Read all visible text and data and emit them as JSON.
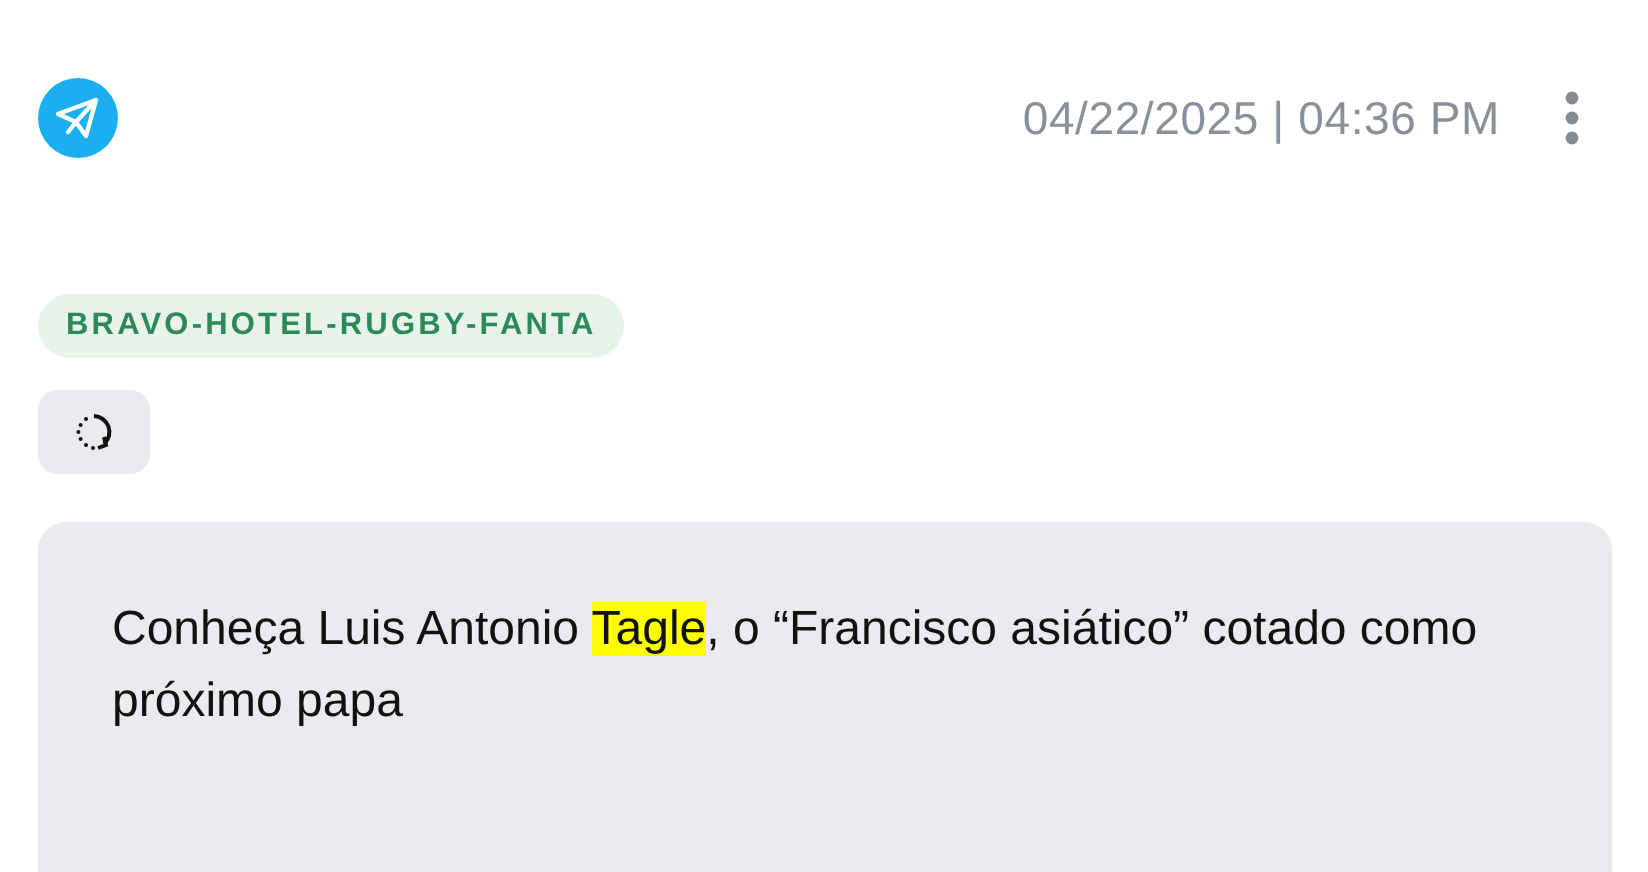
{
  "header": {
    "timestamp": "04/22/2025 | 04:36 PM"
  },
  "tag": {
    "label": "BRAVO-HOTEL-RUGBY-FANTA"
  },
  "message": {
    "parts": [
      {
        "text": "Conheça Luis Antonio ",
        "highlighted": false
      },
      {
        "text": "Tagle",
        "highlighted": true
      },
      {
        "text": ", o “Francisco asiático” cotado como próximo papa",
        "highlighted": false
      }
    ]
  }
}
